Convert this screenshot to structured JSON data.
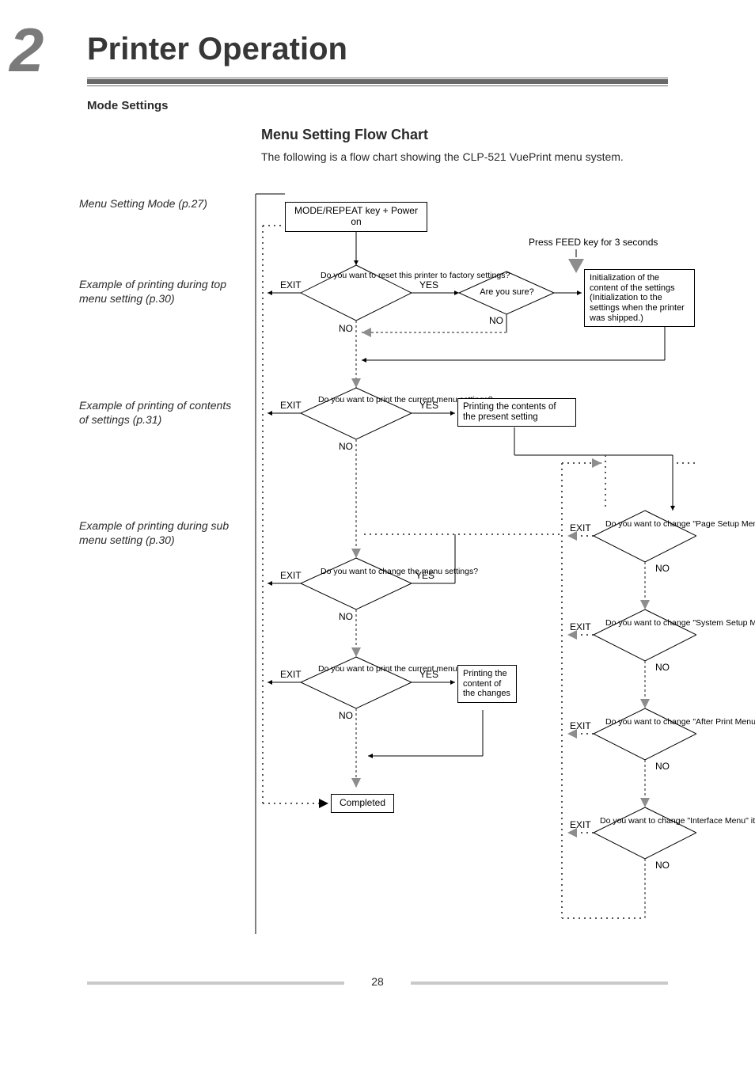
{
  "chapter": {
    "number": "2",
    "title": "Printer Operation"
  },
  "section": {
    "label": "Mode Settings",
    "title": "Menu Setting Flow Chart",
    "intro": "The following is a flow chart showing the CLP-521 VuePrint menu system."
  },
  "sidebar": {
    "ref1": "Menu Setting Mode (p.27)",
    "ref2": "Example of printing during top menu setting (p.30)",
    "ref3": "Example of printing of contents of settings (p.31)",
    "ref4": "Example of printing during sub menu setting (p.30)"
  },
  "flow": {
    "start": "MODE/REPEAT key + Power on",
    "feed_hint": "Press FEED key for 3 seconds",
    "d1": "Do you want to reset this printer to factory settings?",
    "d1_sure": "Are you sure?",
    "init_box": "Initialization of the content of the settings (Initialization to the settings when the printer was shipped.)",
    "d2": "Do you want to print the current menu settings?",
    "print_present": "Printing the contents of the present setting",
    "d3": "Do you want to change the menu settings?",
    "d4": "Do you want to print the current menu settings?",
    "print_changes": "Printing the content of the changes",
    "completed": "Completed",
    "sub_page": "Do you want to change \"Page Setup Menu\" items?",
    "sub_system": "Do you want to change \"System Setup Menu\" items?",
    "sub_after": "Do you want to change \"After Print Menu\" items?",
    "sub_interface": "Do you want to change \"Interface Menu\" items?",
    "yes": "YES",
    "no": "NO",
    "exit": "EXIT"
  },
  "page_number": "28"
}
